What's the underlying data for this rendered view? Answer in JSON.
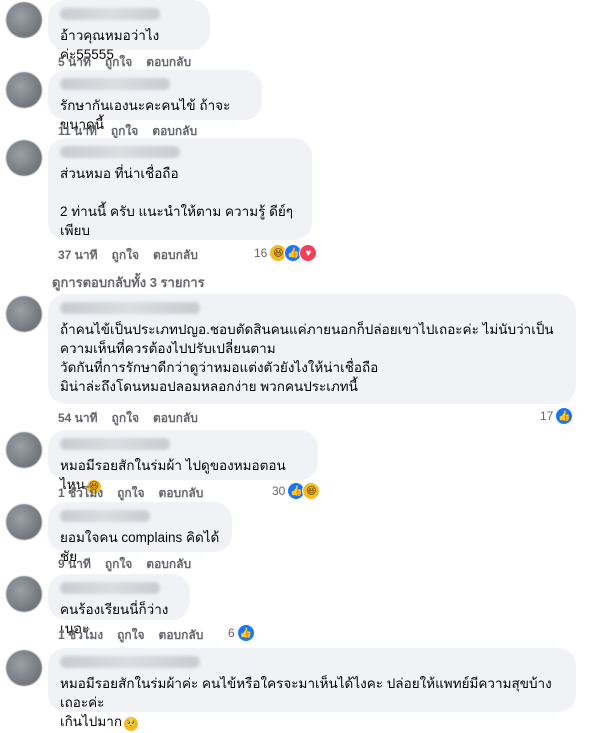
{
  "comments": [
    {
      "text": "อ้าวคุณหมอว่าไงค่ะ55555",
      "time": "5 นาที",
      "like": "ถูกใจ",
      "reply": "ตอบกลับ"
    },
    {
      "text": "รักษากันเองนะคะคนไข้ ถ้าจะขนาดนี้",
      "time": "11 นาที",
      "like": "ถูกใจ",
      "reply": "ตอบกลับ"
    },
    {
      "text": "ส่วนหมอ ที่น่าเชื่อถือ\n\n2 ท่านนี้ ครับ แนะนำให้ตาม ความรู้ ดีย์ๆ เพียบ",
      "time": "37 นาที",
      "like": "ถูกใจ",
      "reply": "ตอบกลับ",
      "reaction_count": "16"
    },
    {
      "text": "ถ้าคนไข้เป็นประเภทปญอ.ชอบตัดสินคนแค่ภายนอกก็ปล่อยเขาไปเถอะค่ะ ไม่นับว่าเป็นความเห็นที่ควรต้องไปปรับเปลี่ยนตาม\nวัดกันที่การรักษาดีกว่าดูว่าหมอแต่งตัวยังไงให้น่าเชื่อถือ\nมิน่าล่ะถึงโดนหมอปลอมหลอกง่าย พวกคนประเภทนี้",
      "time": "54 นาที",
      "like": "ถูกใจ",
      "reply": "ตอบกลับ",
      "reaction_count": "17"
    },
    {
      "text": "หมอมีรอยสักในร่มผ้า ไปดูของหมอตอนไหน",
      "time": "1 ชั่วโมง",
      "like": "ถูกใจ",
      "reply": "ตอบกลับ",
      "reaction_count": "30"
    },
    {
      "text": "ยอมใจคน complains คิดได้ชัย",
      "time": "9 นาที",
      "like": "ถูกใจ",
      "reply": "ตอบกลับ"
    },
    {
      "text": "คนร้องเรียนนี่ก็ว่างเนอะ",
      "time": "1 ชั่วโมง",
      "like": "ถูกใจ",
      "reply": "ตอบกลับ",
      "reaction_count": "6"
    },
    {
      "text": "หมอมีรอยสักในร่มผ้าค่ะ คนไข้หรือใครจะมาเห็นได้ไงคะ ปล่อยให้แพทย์มีความสุขบ้างเถอะค่ะ\nเกินไปมาก"
    }
  ],
  "view_replies": "ดูการตอบกลับทั้ง 3 รายการ",
  "colors": {
    "bubble": "#f0f2f5",
    "meta": "#65676b",
    "like": "#1877f2",
    "haha": "#f7b928",
    "love": "#f33e58"
  }
}
